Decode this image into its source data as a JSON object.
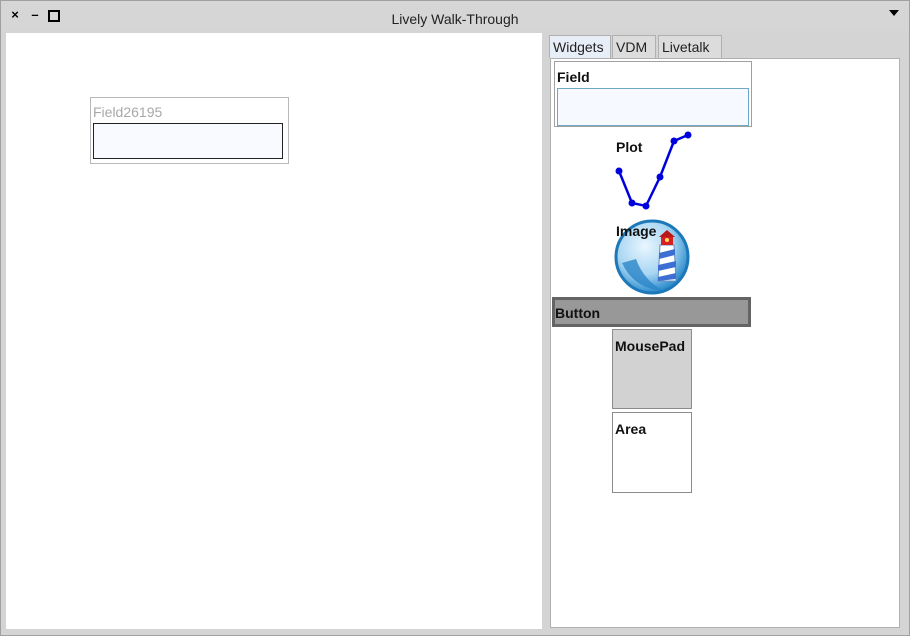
{
  "window": {
    "title": "Lively Walk-Through",
    "close_glyph": "×",
    "minimize_glyph": "–",
    "menu_icon": "dropdown-triangle-icon"
  },
  "world": {
    "field_name": "Field26195",
    "field_value": ""
  },
  "tabs": [
    {
      "label": "Widgets",
      "active": true
    },
    {
      "label": "VDM",
      "active": false
    },
    {
      "label": "Livetalk",
      "active": false
    }
  ],
  "widgets": {
    "field_label": "Field",
    "field_value": "",
    "plot_label": "Plot",
    "plot_color": "#0000dd",
    "image_label": "Image",
    "image_icon": "lighthouse-icon",
    "button_label": "Button",
    "mousepad_label": "MousePad",
    "area_label": "Area"
  }
}
